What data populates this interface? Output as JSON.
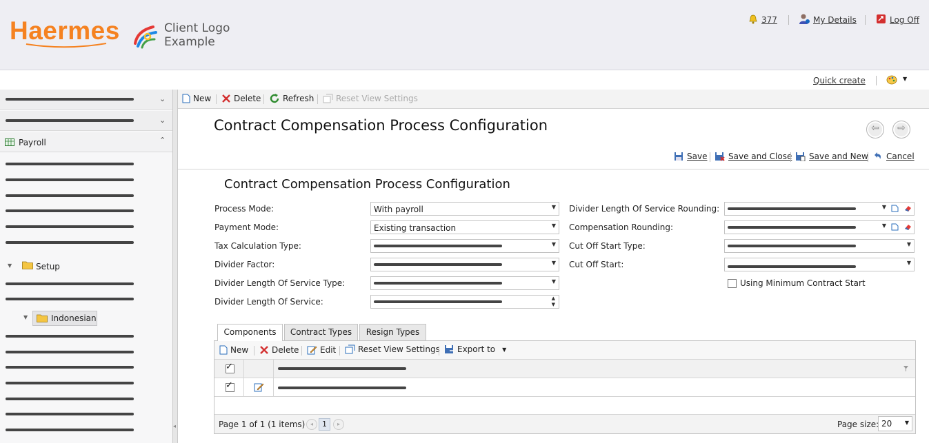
{
  "header": {
    "logo": "Haermes",
    "client_logo": "Client Logo\nExample",
    "notifications_count": "377",
    "my_details": "My Details",
    "log_off": "Log Off",
    "quick_create": "Quick create"
  },
  "sidebar": {
    "payroll_label": "Payroll",
    "setup_label": "Setup",
    "indonesian_label": "Indonesian"
  },
  "toolbar": {
    "new": "New",
    "delete": "Delete",
    "refresh": "Refresh",
    "reset_view_settings": "Reset View Settings"
  },
  "page_title": "Contract Compensation Process Configuration",
  "actions": {
    "save": "Save",
    "save_and_close": "Save and Close",
    "save_and_new": "Save and New",
    "cancel": "Cancel"
  },
  "form": {
    "title": "Contract Compensation Process Configuration",
    "process_mode_label": "Process Mode:",
    "process_mode_value": "With payroll",
    "payment_mode_label": "Payment Mode:",
    "payment_mode_value": "Existing transaction",
    "tax_calculation_type_label": "Tax Calculation Type:",
    "divider_factor_label": "Divider Factor:",
    "divider_los_type_label": "Divider Length Of Service Type:",
    "divider_los_label": "Divider Length Of Service:",
    "divider_los_rounding_label": "Divider Length Of Service Rounding:",
    "compensation_rounding_label": "Compensation Rounding:",
    "cutoff_start_type_label": "Cut Off Start Type:",
    "cutoff_start_label": "Cut Off Start:",
    "using_min_contract_start_label": "Using Minimum Contract Start"
  },
  "tabs": [
    "Components",
    "Contract Types",
    "Resign Types"
  ],
  "grid": {
    "new": "New",
    "delete": "Delete",
    "edit": "Edit",
    "reset_view_settings": "Reset View Settings",
    "export_to": "Export to",
    "pager_text": "Page 1 of 1 (1 items)",
    "current_page": "1",
    "page_size_label": "Page size:",
    "page_size_value": "20"
  },
  "colors": {
    "brand_orange": "#f58220",
    "header_bg": "#eeeef3"
  }
}
